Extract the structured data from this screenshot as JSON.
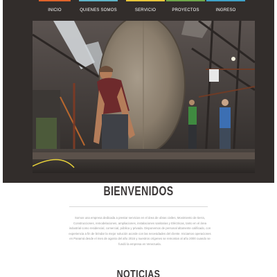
{
  "nav": {
    "items": [
      {
        "label": "INICIO",
        "color": "#e0632a"
      },
      {
        "label": "QUIENES SOMOS",
        "color": "#5fb3c7"
      },
      {
        "label": "SERVICIO",
        "color": "#e8c63a"
      },
      {
        "label": "PROYECTOS",
        "color": "#6fa84a"
      },
      {
        "label": "INGRESO",
        "color": "#3fa2c8"
      }
    ]
  },
  "hero": {
    "image": "workers-in-metal-fabrication-shop"
  },
  "welcome": {
    "title": "BIENVENIDOS",
    "text": "Somos una empresa dedicada a prestar servicios en el área de obras civiles, Movimiento de tierra, Construcciones, remodelaciones, ampliaciones, instalaciones sanitarias y Eléctricas, tanto en el área industrial como residencial, comercial, pública y privada. Disponemos de personal altamente calificado, con experiencia a fin de brindar la mejor solución acorde con las necesidades del cliente. Iniciamos operaciones en Panamá desde el mes de agosto del año 2016 y nuestros orígenes se remontan al año 2000 cuando se fundó la empresa en Venezuela."
  },
  "news": {
    "title": "NOTICIAS"
  },
  "colors": {
    "background_dark": "#322d2b",
    "text_gray": "#9a9a9a",
    "title": "#3b3737"
  }
}
